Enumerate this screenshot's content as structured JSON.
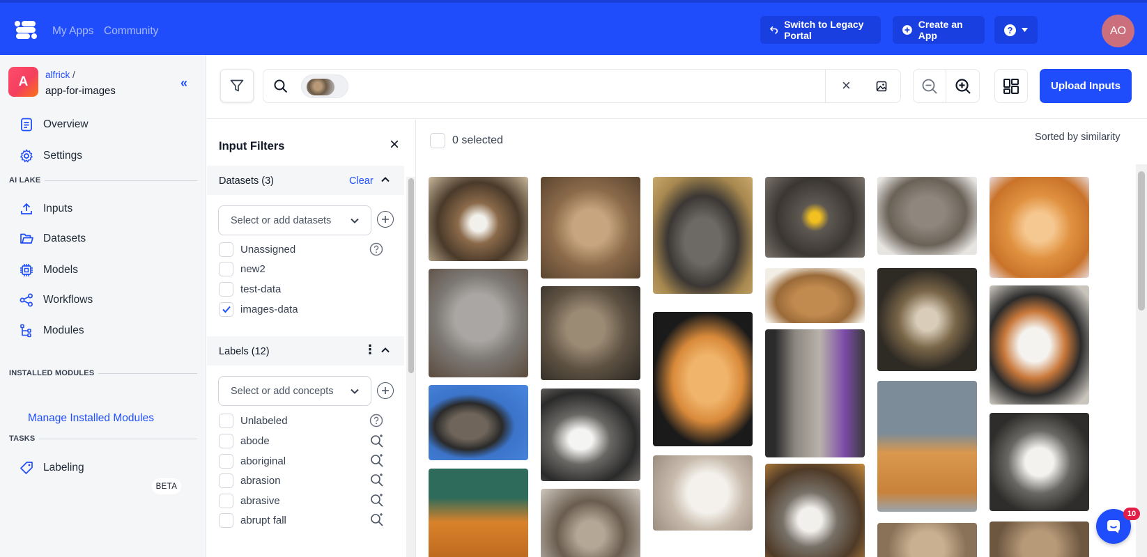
{
  "topnav": {
    "links": [
      "My Apps",
      "Community"
    ],
    "legacy_label": "Switch to Legacy Portal",
    "create_label": "Create an App",
    "help_label": "?",
    "avatar_initials": "AO",
    "brand_color": "#1f4dfb"
  },
  "sidebar": {
    "app_initial": "A",
    "owner": "alfrick",
    "owner_sep": "/",
    "app_name": "app-for-images",
    "collapse_label": "«",
    "top_items": [
      {
        "label": "Overview",
        "icon": "document-icon"
      },
      {
        "label": "Settings",
        "icon": "gear-icon"
      }
    ],
    "ai_lake_title": "AI LAKE",
    "ai_lake_items": [
      {
        "label": "Inputs",
        "icon": "upload-icon"
      },
      {
        "label": "Datasets",
        "icon": "folder-icon"
      },
      {
        "label": "Models",
        "icon": "chip-icon"
      },
      {
        "label": "Workflows",
        "icon": "share-icon"
      },
      {
        "label": "Modules",
        "icon": "tree-icon"
      }
    ],
    "installed_title": "INSTALLED MODULES",
    "manage_link": "Manage Installed Modules",
    "tasks_title": "TASKS",
    "labeling_label": "Labeling",
    "beta_label": "BETA"
  },
  "toolbar": {
    "upload_label": "Upload Inputs",
    "clear_label": "×"
  },
  "filters": {
    "title": "Input Filters",
    "close_label": "×",
    "datasets": {
      "title": "Datasets (3)",
      "clear_label": "Clear",
      "placeholder": "Select or add datasets",
      "options": [
        {
          "label": "Unassigned",
          "checked": false,
          "icon": "help-circle-icon"
        },
        {
          "label": "new2",
          "checked": false
        },
        {
          "label": "test-data",
          "checked": false
        },
        {
          "label": "images-data",
          "checked": true
        }
      ]
    },
    "labels": {
      "title": "Labels (12)",
      "more_label": "⋮",
      "placeholder": "Select or add concepts",
      "options": [
        {
          "label": "Unlabeled",
          "icon": "help-circle-icon"
        },
        {
          "label": "abode",
          "icon": "magic-search-icon"
        },
        {
          "label": "aboriginal",
          "icon": "magic-search-icon"
        },
        {
          "label": "abrasion",
          "icon": "magic-search-icon"
        },
        {
          "label": "abrasive",
          "icon": "magic-search-icon"
        },
        {
          "label": "abrupt fall",
          "icon": "magic-search-icon"
        }
      ]
    }
  },
  "gallery": {
    "selected_text": "0 selected",
    "sort_text": "Sorted by similarity",
    "chat_badge": "10"
  }
}
